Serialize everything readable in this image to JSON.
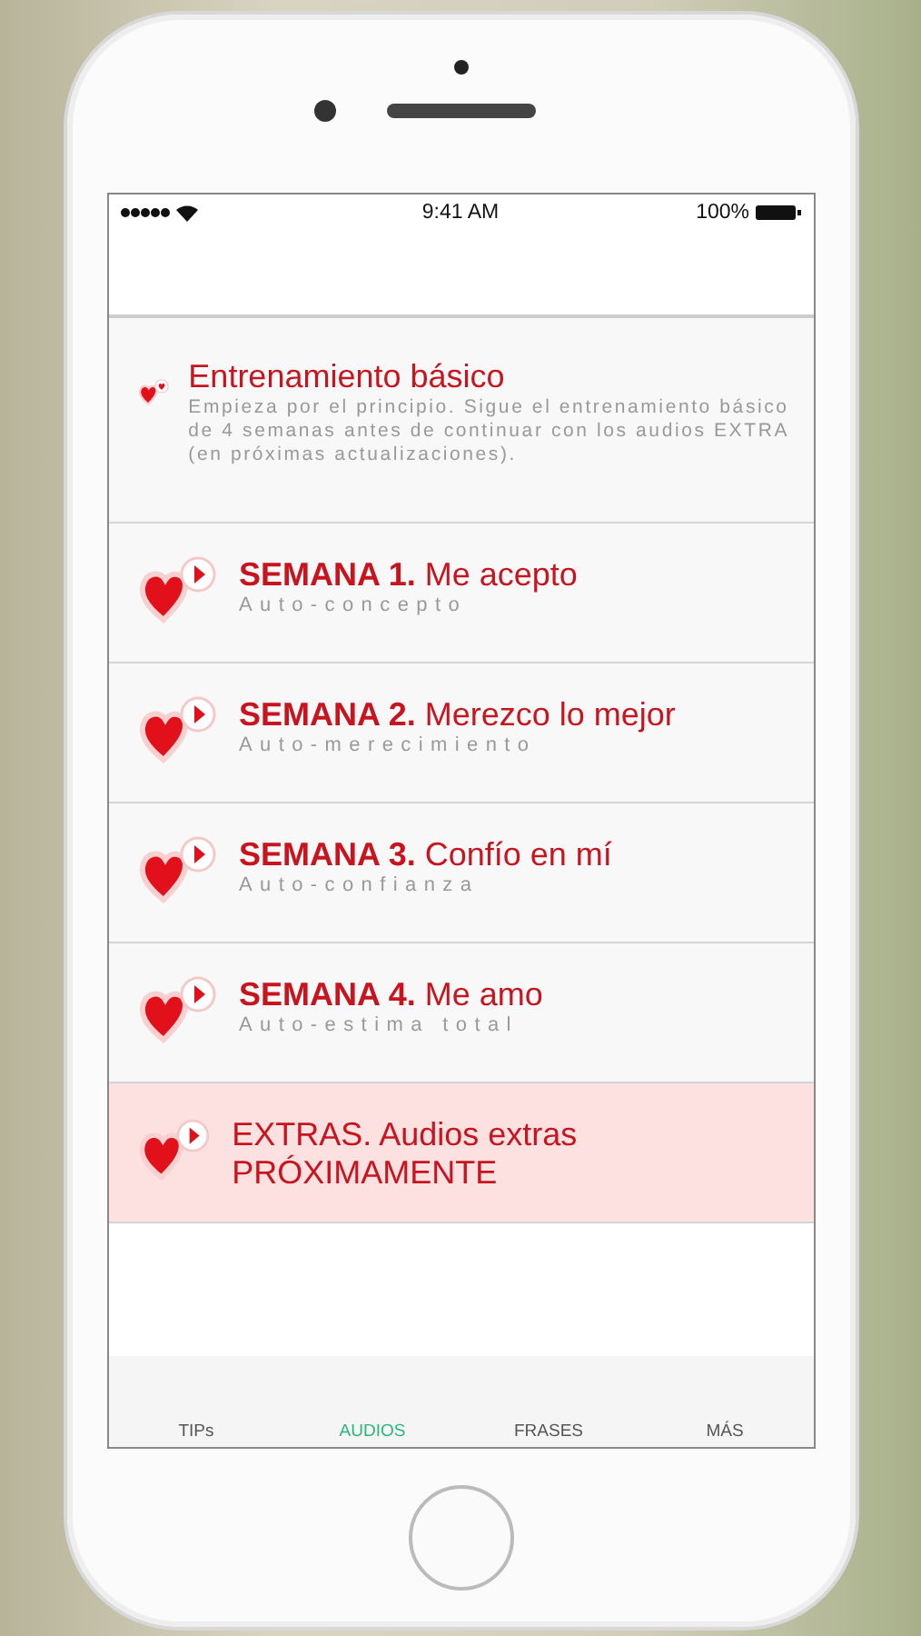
{
  "status_bar": {
    "time": "9:41 AM",
    "battery": "100%"
  },
  "rows": [
    {
      "kind": "intro",
      "title": "Entrenamiento básico",
      "subtitle": "Empieza por el principio. Sigue el entrenamiento básico de 4 semanas antes de continuar con los audios EXTRA (en próximas actualizaciones).",
      "highlighted": false
    },
    {
      "kind": "audio",
      "title": "**SEMANA 1.** Me acepto",
      "subtitle": "Auto-concepto",
      "highlighted": false
    },
    {
      "kind": "audio",
      "title": "**SEMANA 2.** Merezco lo mejor",
      "subtitle": "Auto-merecimiento",
      "highlighted": false
    },
    {
      "kind": "audio",
      "title": "**SEMANA 3.** Confío en mí",
      "subtitle": "Auto-confianza",
      "highlighted": false
    },
    {
      "kind": "audio",
      "title": "**SEMANA 4.** Me amo",
      "subtitle": "Auto-estima total",
      "highlighted": false
    },
    {
      "kind": "audio",
      "title": "EXTRAS. Audios extras PRÓXIMAMENTE",
      "highlighted": true
    }
  ],
  "tabs": [
    {
      "label": "TIPs",
      "selected": false
    },
    {
      "label": "AUDIOS",
      "selected": true
    },
    {
      "label": "FRASES",
      "selected": false
    },
    {
      "label": "MÁS",
      "selected": false
    }
  ]
}
